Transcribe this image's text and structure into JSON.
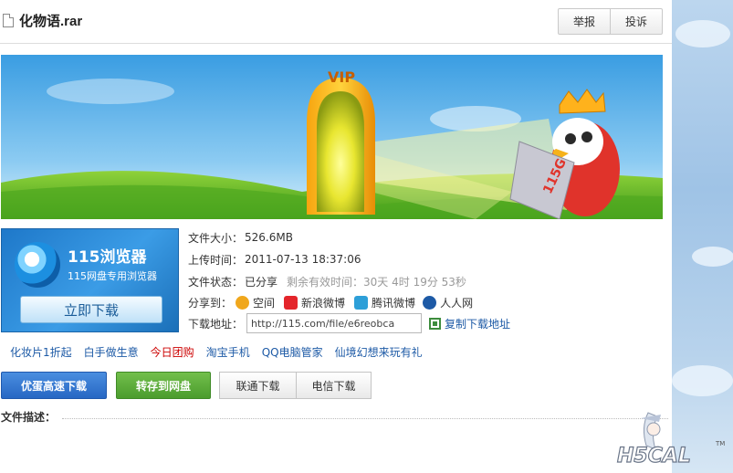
{
  "file": {
    "title": "化物语.rar"
  },
  "header": {
    "report_label": "举报",
    "complain_label": "投诉"
  },
  "banner": {
    "vip_text": "VIP",
    "badge_text": "115G"
  },
  "ad": {
    "title": "115浏览器",
    "subtitle": "115网盘专用浏览器",
    "download_label": "立即下载"
  },
  "info": {
    "size_label": "文件大小：",
    "size_value": "526.6MB",
    "upload_label": "上传时间：",
    "upload_value": "2011-07-13 18:37:06",
    "status_label": "文件状态：",
    "status_value": "已分享",
    "remaining_text": "剩余有效时间：30天 4时 19分 53秒",
    "share_label": "分享到：",
    "share_targets": [
      {
        "label": "空间",
        "color": "#f0a71c"
      },
      {
        "label": "新浪微博",
        "color": "#e4252b"
      },
      {
        "label": "腾讯微博",
        "color": "#2d9fd8"
      },
      {
        "label": "人人网",
        "color": "#1d5aa6"
      }
    ],
    "url_label": "下载地址：",
    "url_value": "http://115.com/file/e6reobca",
    "copy_label": "复制下载地址"
  },
  "promo_links": [
    {
      "label": "化妆片1折起",
      "color": "#1d5aa6"
    },
    {
      "label": "白手做生意",
      "color": "#1d5aa6"
    },
    {
      "label": "今日团购",
      "color": "#cc0000"
    },
    {
      "label": "淘宝手机",
      "color": "#1d5aa6"
    },
    {
      "label": "QQ电脑管家",
      "color": "#1d5aa6"
    },
    {
      "label": "仙境幻想来玩有礼",
      "color": "#1d5aa6"
    }
  ],
  "downloads": {
    "fast_label": "优蛋高速下载",
    "save_label": "转存到网盘",
    "unicom_label": "联通下载",
    "telecom_label": "电信下载"
  },
  "description": {
    "label": "文件描述："
  },
  "watermark": {
    "text": "H5CAL",
    "tm": "TM"
  }
}
